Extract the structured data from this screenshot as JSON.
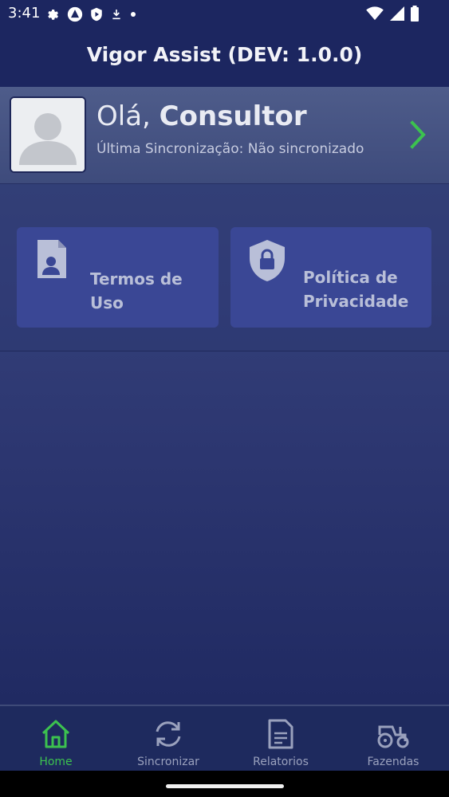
{
  "status_bar": {
    "time": "3:41",
    "icons_left": [
      "gear-icon",
      "vpn-triangle-icon",
      "shield-play-icon",
      "download-icon",
      "dot-icon"
    ],
    "icons_right": [
      "wifi-icon",
      "signal-icon",
      "battery-icon"
    ]
  },
  "app_bar": {
    "title": "Vigor Assist (DEV: 1.0.0)"
  },
  "profile": {
    "greeting_prefix": "Olá,",
    "user_name": "Consultor",
    "sync_status": "Última Sincronização: Não sincronizado"
  },
  "cards": [
    {
      "label": "Termos de Uso",
      "icon": "document-user-icon"
    },
    {
      "label": "Política de Privacidade",
      "icon": "shield-lock-icon"
    }
  ],
  "bottom_nav": {
    "items": [
      {
        "label": "Home",
        "icon": "home-icon",
        "active": true
      },
      {
        "label": "Sincronizar",
        "icon": "sync-icon",
        "active": false
      },
      {
        "label": "Relatorios",
        "icon": "report-icon",
        "active": false
      },
      {
        "label": "Fazendas",
        "icon": "tractor-icon",
        "active": false
      }
    ]
  },
  "colors": {
    "accent_active": "#3cc24f",
    "app_bar": "#1c2660",
    "card": "#3a4795"
  }
}
